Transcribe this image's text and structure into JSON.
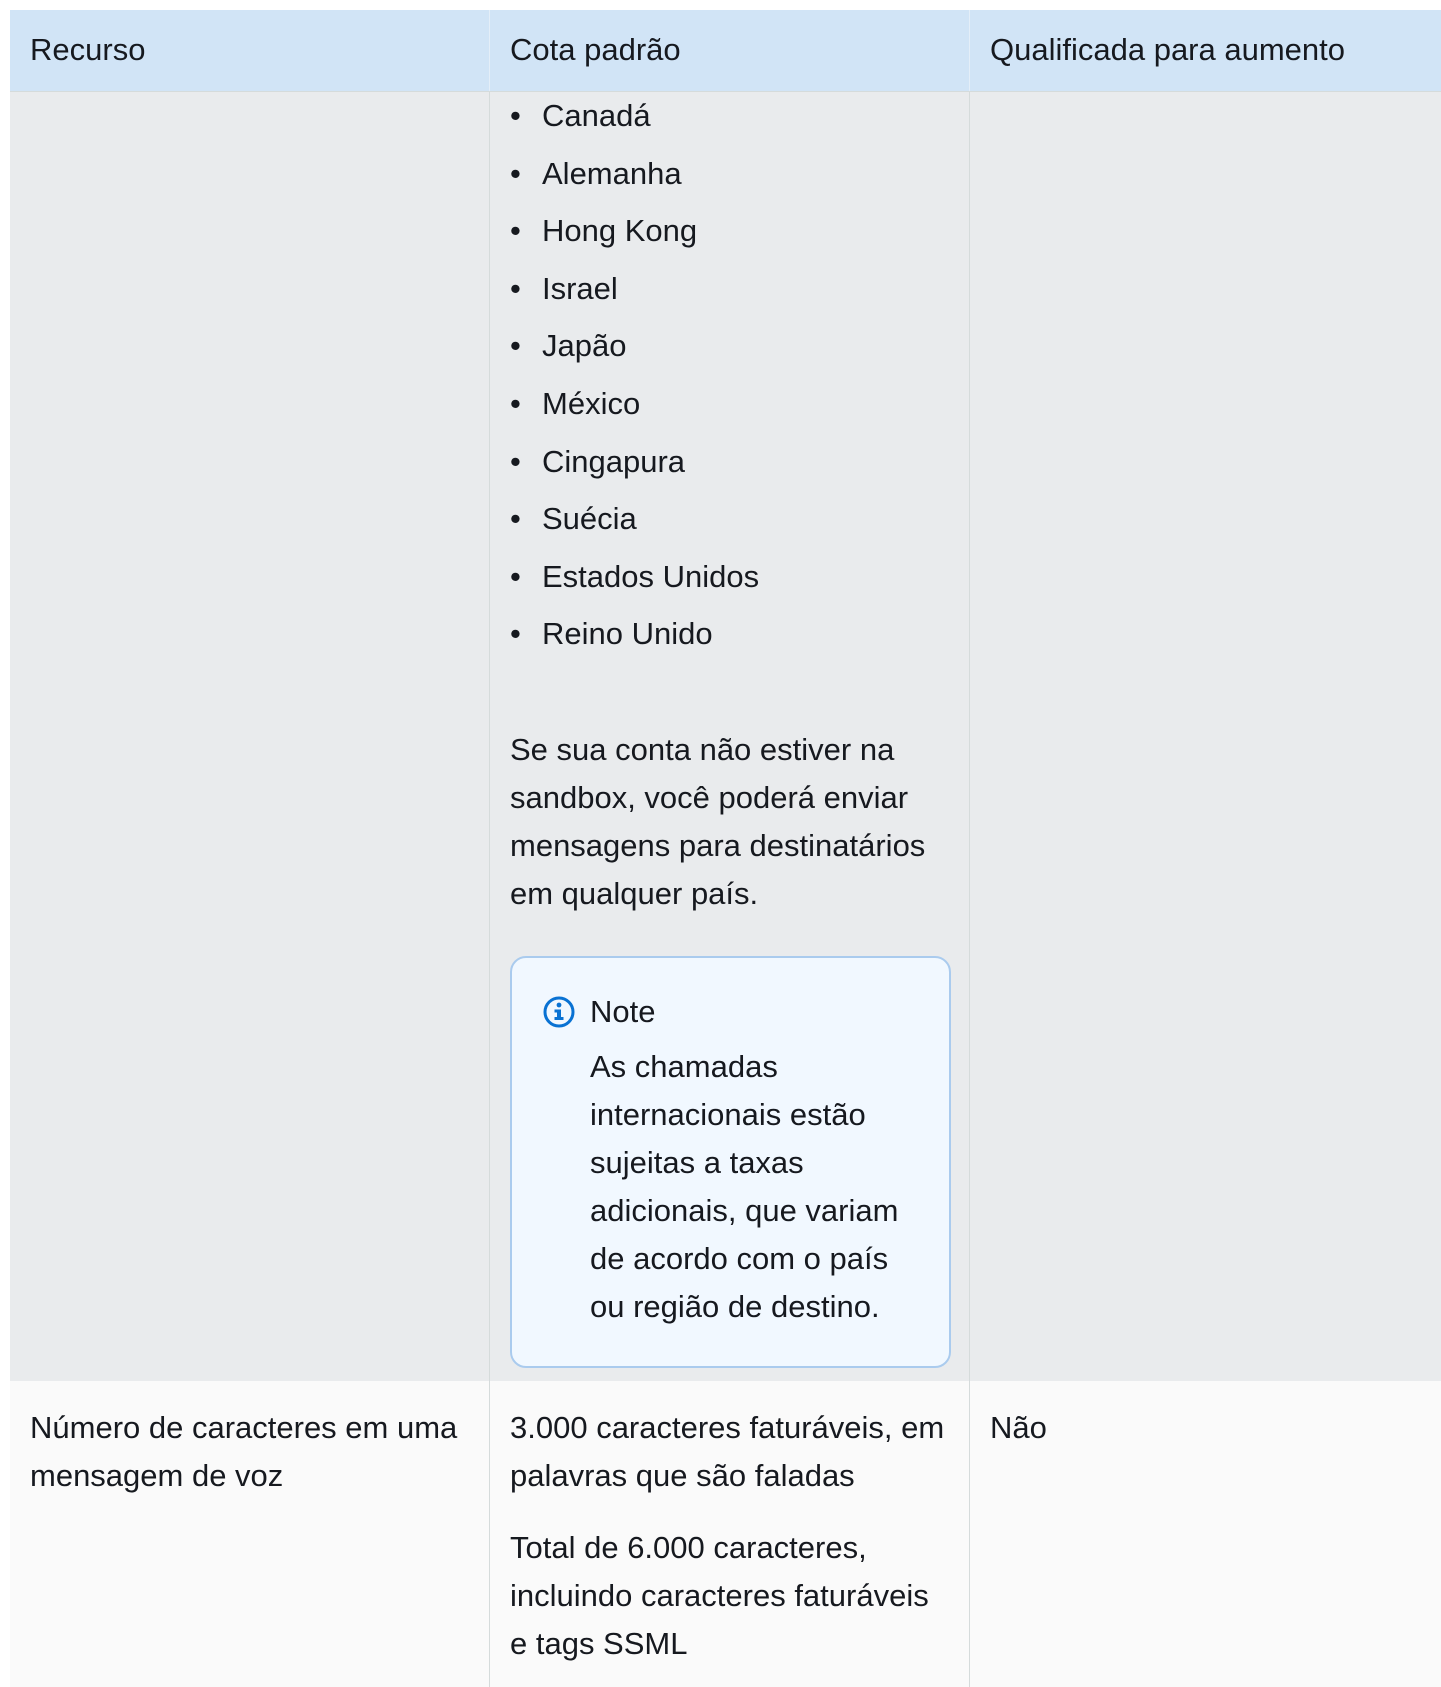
{
  "table": {
    "headers": [
      "Recurso",
      "Cota padrão",
      "Qualificada para aumento"
    ],
    "row1": {
      "countries": [
        "Canadá",
        "Alemanha",
        "Hong Kong",
        "Israel",
        "Japão",
        "México",
        "Cingapura",
        "Suécia",
        "Estados Unidos",
        "Reino Unido"
      ],
      "bullet": "•",
      "paragraph": "Se sua conta não estiver na sandbox, você poderá enviar mensagens para destinatários em qualquer país.",
      "note": {
        "icon": "info-icon",
        "title": "Note",
        "text": "As chamadas internacionais estão sujeitas a taxas adicionais, que variam de acordo com o país ou região de destino."
      }
    },
    "row2": {
      "resource": "Número de caracteres em uma mensagem de voz",
      "quota_line1": "3.000 caracteres faturáveis, em palavras que são faladas",
      "quota_line2": "Total de 6.000 caracteres, incluindo caracteres faturáveis e tags SSML",
      "eligible": "Não"
    }
  },
  "colors": {
    "header_bg": "#d1e4f6",
    "row_alt_bg": "#e9ebed",
    "note_bg": "#f1f8ff",
    "note_border": "#aacbee",
    "info_icon": "#0972d3"
  }
}
